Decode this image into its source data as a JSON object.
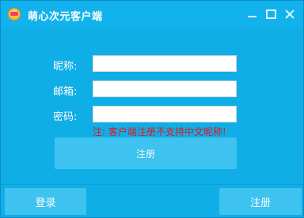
{
  "window": {
    "title": "萌心次元客户端"
  },
  "form": {
    "nickname_label": "昵称:",
    "nickname_value": "",
    "email_label": "邮箱:",
    "email_value": "",
    "password_label": "密码:",
    "password_value": "",
    "warning_text": "注: 客户端注册不支持中文昵称!",
    "register_label": "注册"
  },
  "footer": {
    "login_label": "登录",
    "register_label": "注册"
  },
  "icons": {
    "app": "app-logo-icon",
    "minimize": "minimize-icon",
    "maximize": "maximize-icon",
    "close": "close-icon"
  },
  "colors": {
    "background": "#10aee6",
    "button": "#3ec3f0",
    "warning": "#e8141c"
  }
}
